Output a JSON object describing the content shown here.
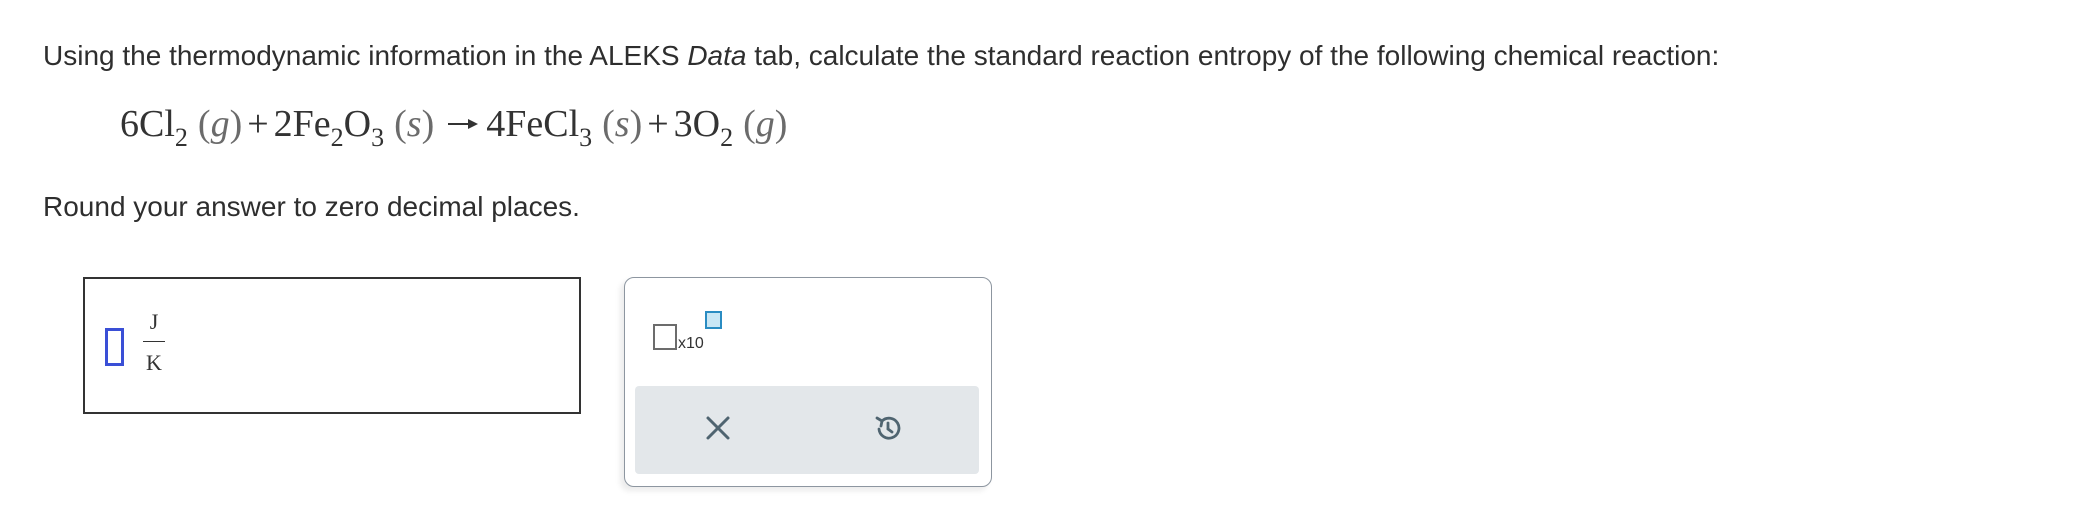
{
  "question": {
    "prompt_before": "Using the thermodynamic information in the ALEKS ",
    "prompt_emphasis": "Data",
    "prompt_after": " tab, calculate the standard reaction entropy of the following chemical reaction:",
    "instructions": "Round your answer to zero decimal places."
  },
  "equation": {
    "reactant1": {
      "coef": "6",
      "element": "Cl",
      "sub": "2",
      "phase": "g"
    },
    "plus1": "+",
    "reactant2": {
      "coef": "2",
      "element1": "Fe",
      "sub1": "2",
      "element2": "O",
      "sub2": "3",
      "phase": "s"
    },
    "product1": {
      "coef": "4",
      "element1": "Fe",
      "element2": "Cl",
      "sub": "3",
      "phase": "s"
    },
    "plus2": "+",
    "product2": {
      "coef": "3",
      "element": "O",
      "sub": "2",
      "phase": "g"
    }
  },
  "answer": {
    "value": "",
    "unit_numerator": "J",
    "unit_denominator": "K"
  },
  "keypad": {
    "sci_notation_label": "x10",
    "clear_icon": "close-icon",
    "undo_icon": "undo-icon",
    "colors": {
      "slot_border": "#3a4fd6",
      "exponent_fill": "#c9e7f5",
      "exponent_border": "#2a8cc2",
      "action_bar": "#e3e7ea",
      "icon": "#4f6470"
    }
  }
}
